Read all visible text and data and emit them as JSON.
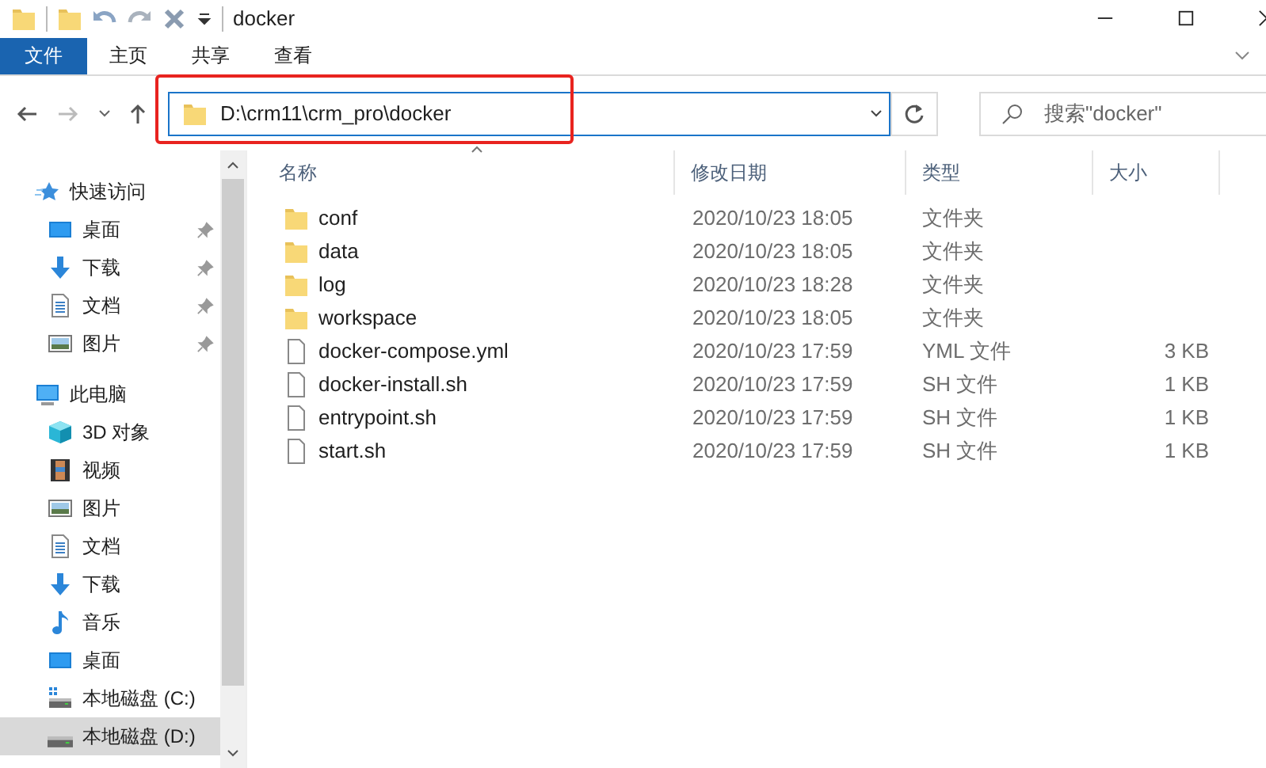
{
  "window": {
    "title": "docker"
  },
  "ribbon_tabs": [
    {
      "label": "文件",
      "selected": true
    },
    {
      "label": "主页",
      "selected": false
    },
    {
      "label": "共享",
      "selected": false
    },
    {
      "label": "查看",
      "selected": false
    }
  ],
  "address_bar": {
    "path": "D:\\crm11\\crm_pro\\docker",
    "highlighted": true
  },
  "search": {
    "placeholder": "搜索\"docker\""
  },
  "sidebar": {
    "items": [
      {
        "label": "快速访问",
        "kind": "star",
        "selected": false,
        "children": [
          {
            "label": "桌面",
            "kind": "desktop",
            "pinned": true,
            "selected": false
          },
          {
            "label": "下载",
            "kind": "download",
            "pinned": true,
            "selected": false
          },
          {
            "label": "文档",
            "kind": "document",
            "pinned": true,
            "selected": false
          },
          {
            "label": "图片",
            "kind": "picture",
            "pinned": true,
            "selected": false
          }
        ]
      },
      {
        "label": "此电脑",
        "kind": "computer",
        "selected": false,
        "children": [
          {
            "label": "3D 对象",
            "kind": "cube",
            "pinned": false,
            "selected": false
          },
          {
            "label": "视频",
            "kind": "video",
            "pinned": false,
            "selected": false
          },
          {
            "label": "图片",
            "kind": "picture",
            "pinned": false,
            "selected": false
          },
          {
            "label": "文档",
            "kind": "document",
            "pinned": false,
            "selected": false
          },
          {
            "label": "下载",
            "kind": "download",
            "pinned": false,
            "selected": false
          },
          {
            "label": "音乐",
            "kind": "music",
            "pinned": false,
            "selected": false
          },
          {
            "label": "桌面",
            "kind": "desktop",
            "pinned": false,
            "selected": false
          },
          {
            "label": "本地磁盘 (C:)",
            "kind": "system-drive",
            "pinned": false,
            "selected": false
          },
          {
            "label": "本地磁盘 (D:)",
            "kind": "drive",
            "pinned": false,
            "selected": true
          }
        ]
      }
    ]
  },
  "table": {
    "columns": [
      "名称",
      "修改日期",
      "类型",
      "大小"
    ],
    "rows": [
      {
        "name": "conf",
        "date": "2020/10/23 18:05",
        "type": "文件夹",
        "kind": "folder"
      },
      {
        "name": "data",
        "date": "2020/10/23 18:05",
        "type": "文件夹",
        "kind": "folder"
      },
      {
        "name": "log",
        "date": "2020/10/23 18:28",
        "type": "文件夹",
        "kind": "folder"
      },
      {
        "name": "workspace",
        "date": "2020/10/23 18:05",
        "type": "文件夹",
        "kind": "folder"
      },
      {
        "name": "docker-compose.yml",
        "date": "2020/10/23 17:59",
        "type": "YML 文件",
        "size": "3 KB",
        "kind": "file"
      },
      {
        "name": "docker-install.sh",
        "date": "2020/10/23 17:59",
        "type": "SH 文件",
        "size": "1 KB",
        "kind": "file"
      },
      {
        "name": "entrypoint.sh",
        "date": "2020/10/23 17:59",
        "type": "SH 文件",
        "size": "1 KB",
        "kind": "file"
      },
      {
        "name": "start.sh",
        "date": "2020/10/23 17:59",
        "type": "SH 文件",
        "size": "1 KB",
        "kind": "file"
      }
    ]
  }
}
